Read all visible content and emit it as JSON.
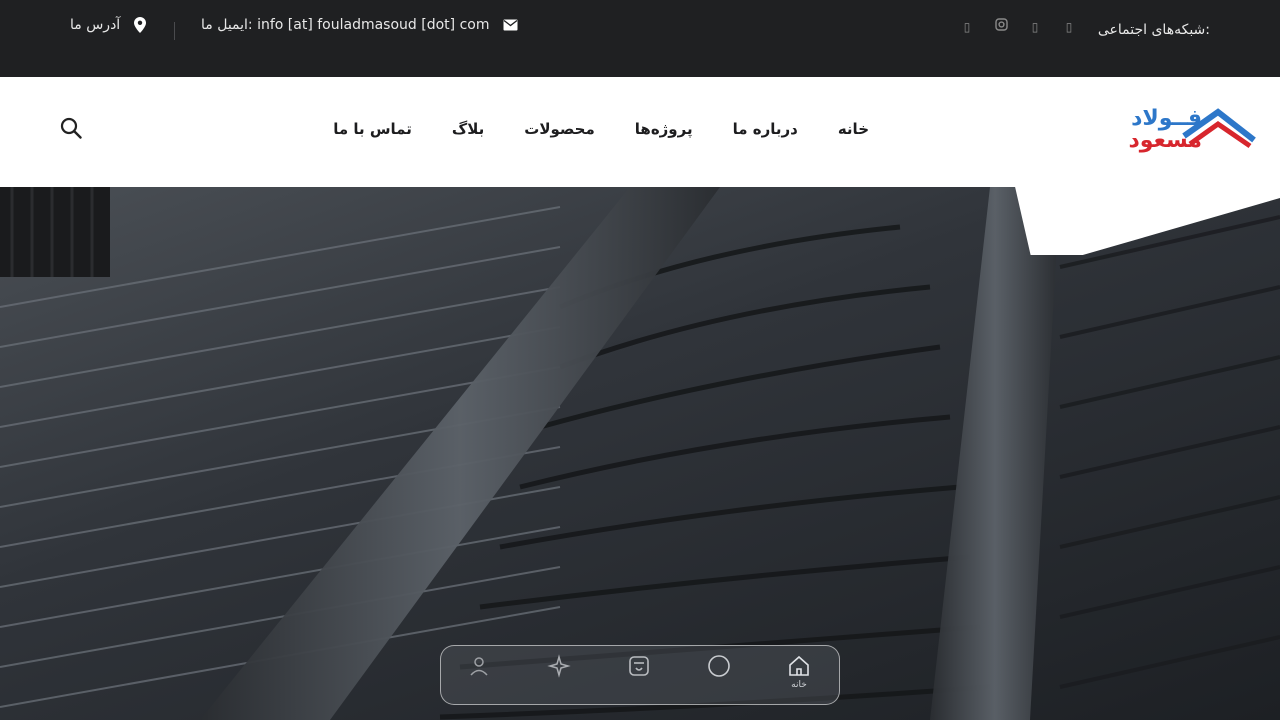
{
  "topbar": {
    "social_label": "شبکه‌های اجتماعی:",
    "social_icons": [
      "facebook-icon",
      "twitter-icon",
      "instagram-icon",
      "linkedin-icon"
    ],
    "email_text": "ایمیل ما: info [at] fouladmasoud [dot] com",
    "address_text": "آدرس ما"
  },
  "brand": {
    "line1": "فــولاد",
    "line2": "مسعود",
    "colors": {
      "blue": "#2d77c9",
      "red": "#d7262d"
    }
  },
  "nav": {
    "items": [
      "خانه",
      "درباره ما",
      "پروژه‌ها",
      "محصولات",
      "بلاگ",
      "تماس با ما"
    ]
  },
  "dock": {
    "home_label": "خانه",
    "icons": [
      "home-icon",
      "circle-icon",
      "store-icon",
      "sparkle-icon",
      "user-icon"
    ]
  }
}
